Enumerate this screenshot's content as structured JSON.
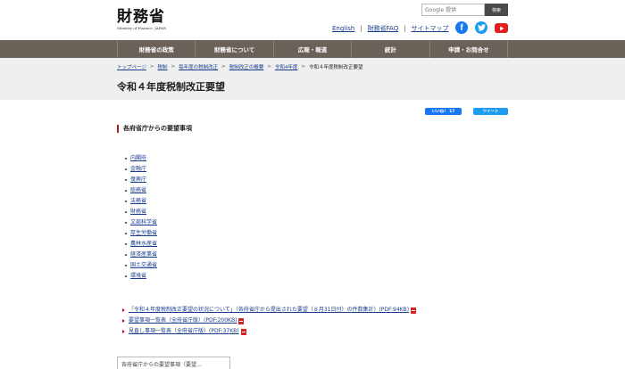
{
  "header": {
    "logo_jp": "財務省",
    "logo_en": "Ministry of Finance, JAPAN",
    "search_placeholder": "Google 提供",
    "search_button": "検索",
    "util_links": [
      "English",
      "財務省FAQ",
      "サイトマップ"
    ],
    "util_sep": "|",
    "facebook_glyph": "f"
  },
  "nav": {
    "items": [
      "財務省の政策",
      "財務省について",
      "広報・報道",
      "統計",
      "申請・お問合せ"
    ]
  },
  "breadcrumb": {
    "items": [
      "トップページ",
      "税制",
      "毎年度の税制改正",
      "税制改正の概要",
      "令和4年度"
    ],
    "current": "令和４年度税制改正要望",
    "sep": ">"
  },
  "page": {
    "title": "令和４年度税制改正要望"
  },
  "share": {
    "facebook": "いいね！ 17",
    "twitter": "ツイート"
  },
  "section": {
    "heading": "各府省庁からの要望事項"
  },
  "ministries": [
    "内閣府",
    "金融庁",
    "復興庁",
    "総務省",
    "法務省",
    "財務省",
    "文部科学省",
    "厚生労働省",
    "農林水産省",
    "経済産業省",
    "国土交通省",
    "環境省"
  ],
  "documents": [
    "「令和４年度税制改正要望の状況について」（各府省庁から提出された要望（８月31日付）の件数集計）(PDF:94KB)",
    "要望事項一覧表（全府省庁版）(PDF:200KB)",
    "見直し事項一覧表（全府省庁版）(PDF:37KB)"
  ],
  "bottom_box": "各府省庁からの要望事項（要望…",
  "colors": {
    "nav_bg": "#6a6259",
    "accent_red": "#b2171e",
    "link": "#1a3e8f"
  }
}
